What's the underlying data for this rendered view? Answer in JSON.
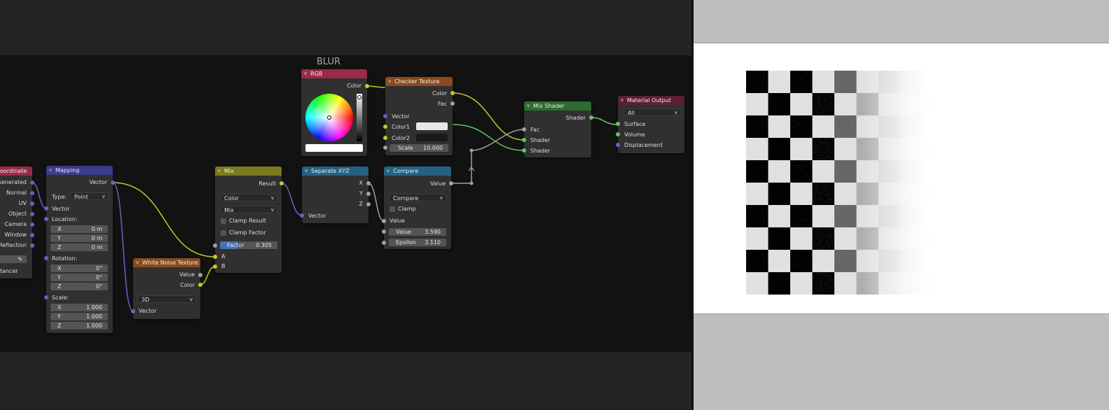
{
  "frame": {
    "label": "BLUR"
  },
  "colors": {
    "vector_socket": "#6363c7",
    "color_socket": "#c7c729",
    "float_socket": "#a1a1a1",
    "shader_socket": "#63c763"
  },
  "nodes": {
    "texcoord": {
      "title": "oordinate",
      "outputs": [
        "Generated",
        "Normal",
        "UV",
        "Object",
        "Camera",
        "Window",
        "Reflection"
      ],
      "footer": "tancer"
    },
    "mapping": {
      "title": "Mapping",
      "output": "Vector",
      "type_label": "Type:",
      "type_value": "Point",
      "input_vector": "Vector",
      "location_label": "Location:",
      "location": [
        {
          "axis": "X",
          "value": "0 m"
        },
        {
          "axis": "Y",
          "value": "0 m"
        },
        {
          "axis": "Z",
          "value": "0 m"
        }
      ],
      "rotation_label": "Rotation:",
      "rotation": [
        {
          "axis": "X",
          "value": "0°"
        },
        {
          "axis": "Y",
          "value": "0°"
        },
        {
          "axis": "Z",
          "value": "0°"
        }
      ],
      "scale_label": "Scale:",
      "scale": [
        {
          "axis": "X",
          "value": "1.000"
        },
        {
          "axis": "Y",
          "value": "1.000"
        },
        {
          "axis": "Z",
          "value": "1.000"
        }
      ]
    },
    "white_noise": {
      "title": "White Noise Texture",
      "outputs": [
        "Value",
        "Color"
      ],
      "dimension": "3D",
      "input": "Vector"
    },
    "mix": {
      "title": "Mix",
      "output": "Result",
      "data_type": "Color",
      "blend_type": "Mix",
      "clamp_result": "Clamp Result",
      "clamp_factor": "Clamp Factor",
      "factor_label": "Factor",
      "factor_value": "0.305",
      "factor": 0.305,
      "input_a": "A",
      "input_b": "B"
    },
    "rgb": {
      "title": "RGB",
      "output": "Color"
    },
    "separate_xyz": {
      "title": "Separate XYZ",
      "outputs": [
        "X",
        "Y",
        "Z"
      ],
      "input": "Vector"
    },
    "checker": {
      "title": "Checker Texture",
      "outputs": [
        "Color",
        "Fac"
      ],
      "input_vector": "Vector",
      "color1": "Color1",
      "color2": "Color2",
      "scale_label": "Scale",
      "scale_value": "10.000",
      "color1_hex": "#e8e8e8",
      "color2_hex": "#1a1a1a"
    },
    "compare": {
      "title": "Compare",
      "output": "Value",
      "operation": "Compare",
      "clamp": "Clamp",
      "input_value": "Value",
      "value_label": "Value",
      "value_value": "3.590",
      "epsilon_label": "Epsilon",
      "epsilon_value": "3.110"
    },
    "mix_shader": {
      "title": "Mix Shader",
      "output": "Shader",
      "inputs": [
        "Fac",
        "Shader",
        "Shader"
      ]
    },
    "material_output": {
      "title": "Material Output",
      "target": "All",
      "inputs": [
        "Surface",
        "Volume",
        "Displacement"
      ]
    }
  },
  "header_colors": {
    "texcoord": "#9b2a4a",
    "mapping": "#3b3c8c",
    "white_noise": "#8a4b1e",
    "mix": "#7a7a1e",
    "rgb": "#9b2a4a",
    "separate_xyz": "#246283",
    "checker": "#8a4b1e",
    "compare": "#246283",
    "mix_shader": "#2e6b2e",
    "material_output": "#5c1f31"
  }
}
